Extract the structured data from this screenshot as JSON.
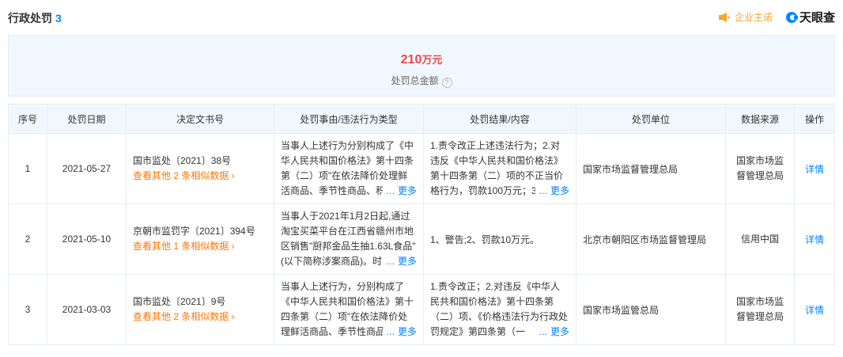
{
  "header": {
    "title": "行政处罚",
    "count": "3",
    "notice": "企业主诺",
    "brand": "天眼查"
  },
  "summary": {
    "amount_value": "210",
    "amount_unit": "万元",
    "amount_label": "处罚总金额",
    "help_glyph": "?"
  },
  "table": {
    "columns": [
      "序号",
      "处罚日期",
      "决定文书号",
      "处罚事由/违法行为类型",
      "处罚结果/内容",
      "处罚单位",
      "数据来源",
      "操作"
    ],
    "more_label": "… 更多",
    "rows": [
      {
        "index": "1",
        "date": "2021-05-27",
        "doc_no": "国市监处〔2021〕38号",
        "similar": "查看其他 2 条相似数据 ›",
        "reason": "当事人上述行为分别构成了《中华人民共和国价格法》第十四条第（二）项\"在依法降价处理鲜活商品、季节性商品、积压",
        "result": "1.责令改正上述违法行为；2.对违反《中华人民共和国价格法》第十四条第（二）项的不正当价格行为，罚款100万元；3.对",
        "unit": "国家市场监督管理总局",
        "source": "国家市场监督管理总局",
        "action": "详情"
      },
      {
        "index": "2",
        "date": "2021-05-10",
        "doc_no": "京朝市监罚字〔2021〕394号",
        "similar": "查看其他 1 条相似数据 ›",
        "reason": "当事人于2021年1月2日起,通过淘宝买菜平台在江西省赣州市地区销售\"厨邦金品生抽1.63L食品\"(以下简称涉案商品)。时",
        "result": "1、警告;2、罚款10万元。",
        "unit": "北京市朝阳区市场监督管理局",
        "source": "信用中国",
        "action": "详情"
      },
      {
        "index": "3",
        "date": "2021-03-03",
        "doc_no": "国市监处〔2021〕9号",
        "similar": "查看其他 2 条相似数据 ›",
        "reason": "当事人上述行为，分别构成了《中华人民共和国价格法》第十四条第（二）项\"在依法降价处理鲜活商品、季节性商品、",
        "result": "1.责令改正；2.对违反《中华人民共和国价格法》第十四条第（二）项、《价格违法行为行政处罚规定》第四条第（一",
        "unit": "国家市场监管总局",
        "source": "国家市场监督管理总局",
        "action": "详情"
      }
    ]
  }
}
